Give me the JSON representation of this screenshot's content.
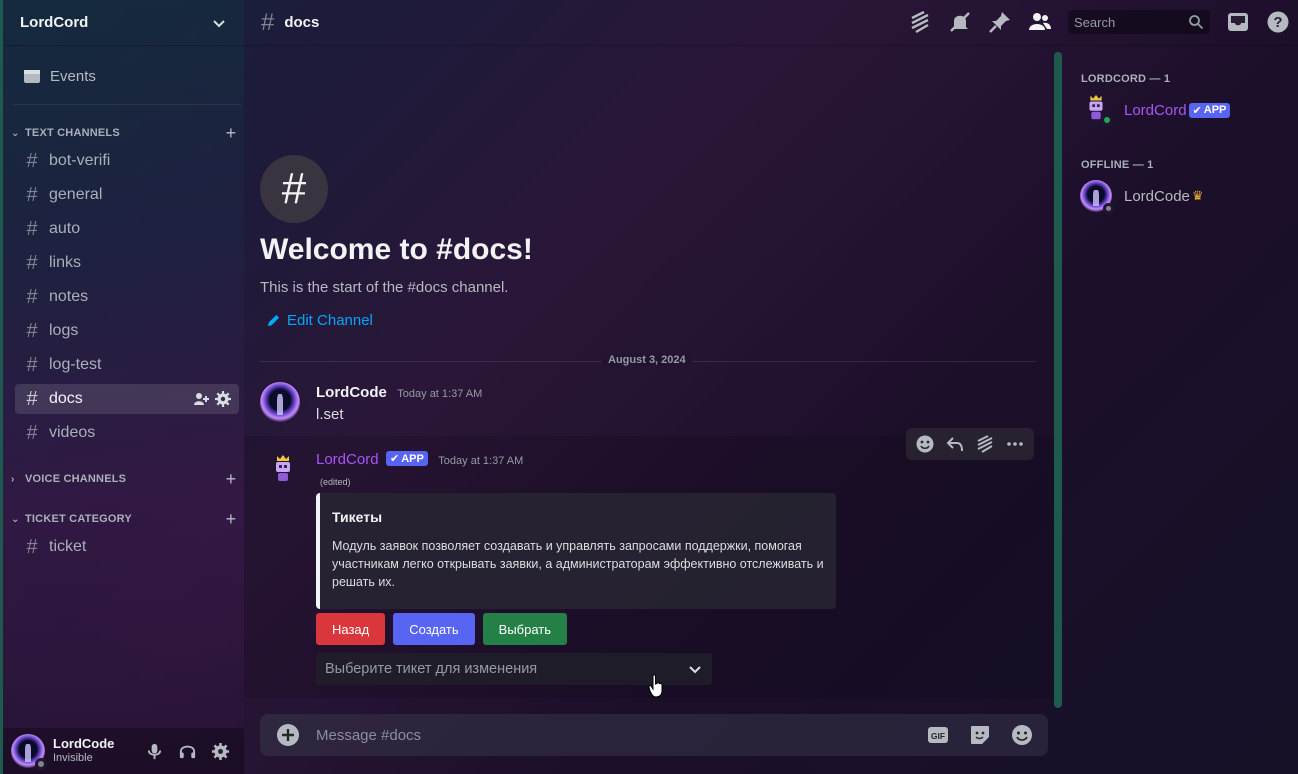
{
  "server": {
    "name": "LordCord"
  },
  "sidebar": {
    "events_label": "Events",
    "categories": {
      "text": "TEXT CHANNELS",
      "voice": "VOICE CHANNELS",
      "ticket": "TICKET CATEGORY"
    },
    "channels": [
      {
        "name": "bot-verifi"
      },
      {
        "name": "general"
      },
      {
        "name": "auto"
      },
      {
        "name": "links"
      },
      {
        "name": "notes"
      },
      {
        "name": "logs"
      },
      {
        "name": "log-test"
      },
      {
        "name": "docs",
        "active": true
      },
      {
        "name": "videos"
      }
    ],
    "ticket_channels": [
      {
        "name": "ticket"
      }
    ]
  },
  "user": {
    "name": "LordCode",
    "status": "Invisible"
  },
  "header": {
    "channel": "docs",
    "search_placeholder": "Search"
  },
  "welcome": {
    "title": "Welcome to #docs!",
    "subtitle": "This is the start of the #docs channel.",
    "edit_label": "Edit Channel"
  },
  "date_divider": "August 3, 2024",
  "messages": [
    {
      "author": "LordCode",
      "time": "Today at 1:37 AM",
      "content": "l.set"
    },
    {
      "author": "LordCord",
      "badge": "APP",
      "time": "Today at 1:37 AM",
      "edited": "(edited)",
      "embed": {
        "title": "Тикеты",
        "description": "Модуль заявок позволяет создавать и управлять запросами поддержки, помогая участникам легко открывать заявки, а администраторам эффективно отслеживать и решать их."
      },
      "buttons": {
        "back": "Назад",
        "create": "Создать",
        "choose": "Выбрать"
      },
      "select_placeholder": "Выберите тикет для изменения"
    }
  ],
  "composer": {
    "placeholder": "Message #docs",
    "gif_label": "GIF"
  },
  "members": {
    "online_header": "LORDCORD — 1",
    "offline_header": "OFFLINE — 1",
    "online": [
      {
        "name": "LordCord",
        "badge": "APP"
      }
    ],
    "offline": [
      {
        "name": "LordCode"
      }
    ]
  },
  "colors": {
    "accent": "#5865f2",
    "danger": "#da373c",
    "success": "#248046",
    "bot_name": "#a855f7",
    "link": "#00a8fc"
  }
}
